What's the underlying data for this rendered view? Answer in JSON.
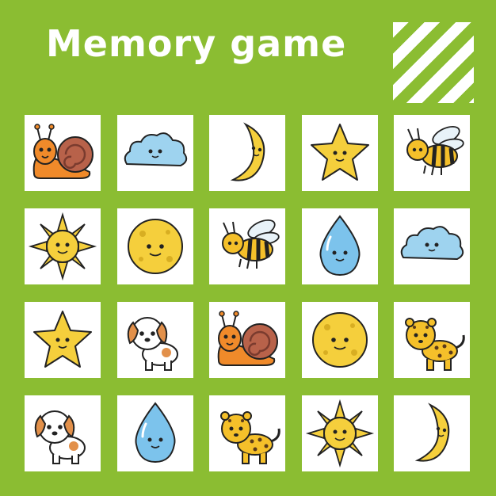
{
  "title": "Memory game",
  "colors": {
    "background": "#8bbd32",
    "card": "#ffffff"
  },
  "grid": {
    "rows": 4,
    "cols": 5,
    "cards": [
      "snail",
      "cloud",
      "moon",
      "star",
      "bee",
      "sun",
      "full-moon",
      "bee",
      "water-drop",
      "cloud",
      "star",
      "puppy",
      "snail",
      "full-moon",
      "leopard",
      "puppy",
      "water-drop",
      "leopard",
      "sun",
      "moon"
    ]
  }
}
